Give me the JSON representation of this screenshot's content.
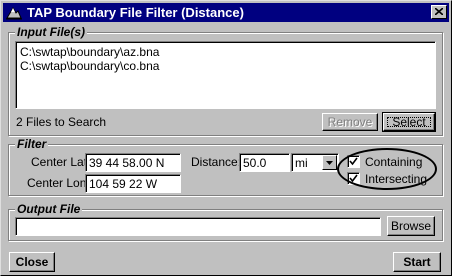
{
  "window": {
    "title": "TAP Boundary File Filter (Distance)"
  },
  "input_files": {
    "legend": "Input File(s)",
    "files": [
      "C:\\swtap\\boundary\\az.bna",
      "C:\\swtap\\boundary\\co.bna"
    ],
    "status": "2 Files to Search",
    "remove_label": "Remove",
    "select_label": "Select"
  },
  "filter": {
    "legend": "Filter",
    "center_lat_label": "Center Lat:",
    "center_lat_value": "39 44 58.00 N",
    "center_lon_label": "Center Lon:",
    "center_lon_value": "104 59 22 W",
    "distance_label": "Distance:",
    "distance_value": "50.0",
    "unit_value": "mi",
    "containing_label": "Containing",
    "containing_checked": true,
    "intersecting_label": "Intersecting",
    "intersecting_checked": true
  },
  "output_file": {
    "legend": "Output File",
    "value": "",
    "browse_label": "Browse"
  },
  "footer": {
    "close_label": "Close",
    "start_label": "Start"
  },
  "icons": {
    "app": "tap-app-icon",
    "close": "close-icon",
    "dropdown": "chevron-down-icon",
    "check": "check-icon"
  }
}
